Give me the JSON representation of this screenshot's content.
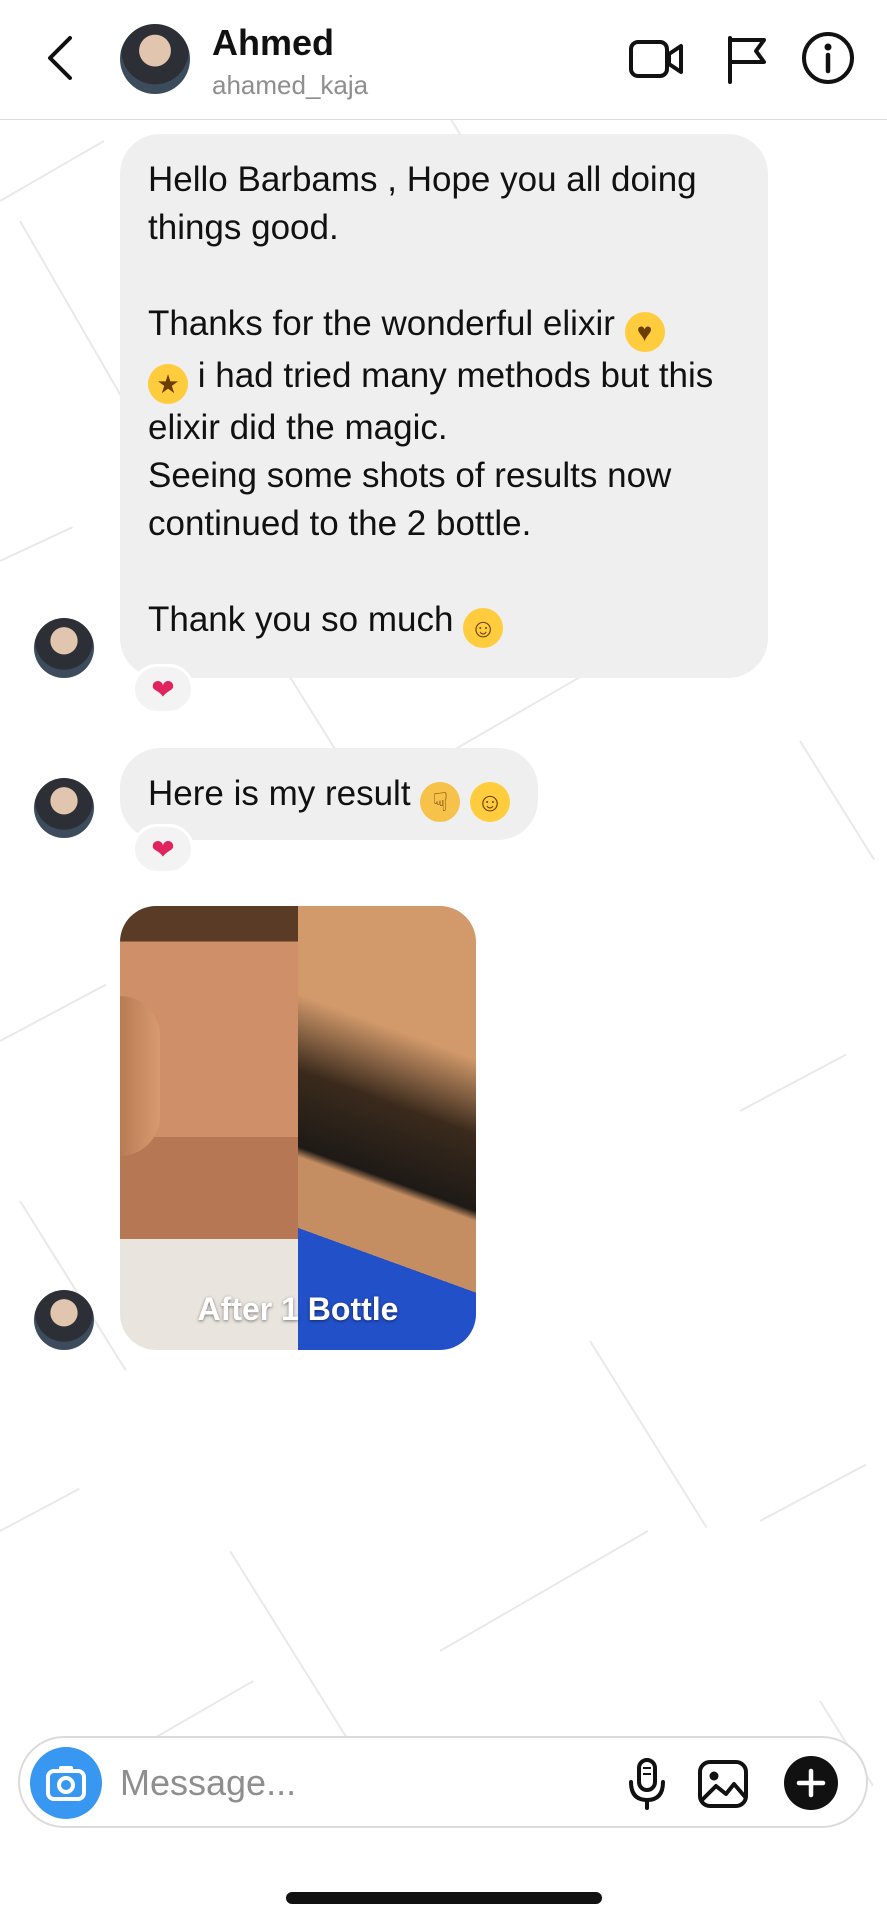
{
  "header": {
    "name": "Ahmed",
    "username": "ahamed_kaja",
    "icons": [
      "back-icon",
      "video-call-icon",
      "flag-icon",
      "info-icon"
    ]
  },
  "messages": [
    {
      "type": "text",
      "paragraphs": [
        "Hello Barbams , Hope you all doing things good.",
        "Thanks for the wonderful elixir",
        "i had tried many methods but this elixir did the magic.",
        "Seeing some shots of results now continued to the 2 bottle.",
        "Thank you so much"
      ],
      "emojis": [
        "heart-eyes-emoji",
        "star-struck-emoji",
        "smiling-emoji"
      ],
      "reaction": "❤"
    },
    {
      "type": "text",
      "text": "Here is my result",
      "emojis": [
        "pointing-down-emoji",
        "grinning-emoji"
      ],
      "reaction": "❤"
    },
    {
      "type": "image",
      "caption": "After 1 Bottle"
    }
  ],
  "composer": {
    "placeholder": "Message...",
    "icons": [
      "camera-icon",
      "microphone-icon",
      "gallery-icon",
      "plus-icon"
    ]
  },
  "colors": {
    "accent": "#3897f0",
    "bubble": "#efefef",
    "heart": "#e0245e"
  }
}
